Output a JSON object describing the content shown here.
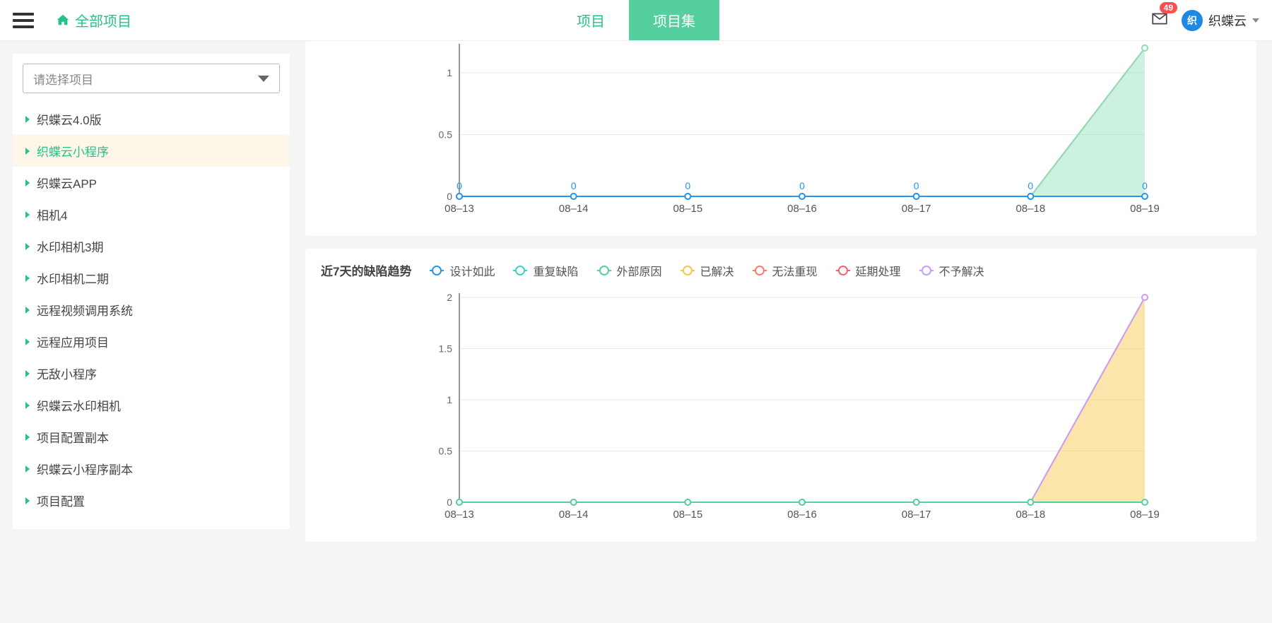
{
  "header": {
    "all_projects": "全部项目",
    "tab_project": "项目",
    "tab_collection": "项目集",
    "badge": "49",
    "username": "织蝶云"
  },
  "sidebar": {
    "select_placeholder": "请选择项目",
    "items": [
      {
        "label": "织蝶云4.0版",
        "active": false
      },
      {
        "label": "织蝶云小程序",
        "active": true
      },
      {
        "label": "织蝶云APP",
        "active": false
      },
      {
        "label": "相机4",
        "active": false
      },
      {
        "label": "水印相机3期",
        "active": false
      },
      {
        "label": "水印相机二期",
        "active": false
      },
      {
        "label": "远程视频调用系统",
        "active": false
      },
      {
        "label": "远程应用项目",
        "active": false
      },
      {
        "label": "无敌小程序",
        "active": false
      },
      {
        "label": "织蝶云水印相机",
        "active": false
      },
      {
        "label": "项目配置副本",
        "active": false
      },
      {
        "label": "织蝶云小程序副本",
        "active": false
      },
      {
        "label": "项目配置",
        "active": false
      }
    ]
  },
  "chart_data": [
    {
      "id": "top",
      "type": "area",
      "title": "",
      "categories": [
        "08–13",
        "08–14",
        "08–15",
        "08–16",
        "08–17",
        "08–18",
        "08–19"
      ],
      "yticks": [
        0,
        0.5,
        1
      ],
      "ylim": [
        0,
        1.2
      ],
      "series": [
        {
          "name": "red",
          "color": "#ff5a7a",
          "values": [
            0,
            0,
            0,
            0,
            0,
            0,
            1.2
          ],
          "fill": false
        },
        {
          "name": "green",
          "color": "#8fdfb9",
          "values": [
            0,
            0,
            0,
            0,
            0,
            0,
            1.2
          ],
          "fill": true
        },
        {
          "name": "blue",
          "color": "#2196f3",
          "values": [
            0,
            0,
            0,
            0,
            0,
            0,
            0
          ],
          "fill": false,
          "show_point_labels": true
        }
      ]
    },
    {
      "id": "defects7d",
      "type": "area",
      "title": "近7天的缺陷趋势",
      "categories": [
        "08–13",
        "08–14",
        "08–15",
        "08–16",
        "08–17",
        "08–18",
        "08–19"
      ],
      "yticks": [
        0,
        0.5,
        1,
        1.5,
        2
      ],
      "ylim": [
        0,
        2
      ],
      "legend": [
        {
          "name": "设计如此",
          "color": "#2196f3"
        },
        {
          "name": "重复缺陷",
          "color": "#35d4c7"
        },
        {
          "name": "外部原因",
          "color": "#54cf9d"
        },
        {
          "name": "已解决",
          "color": "#f6c544"
        },
        {
          "name": "无法重现",
          "color": "#ff7a6b"
        },
        {
          "name": "延期处理",
          "color": "#ff5a7a"
        },
        {
          "name": "不予解决",
          "color": "#c79bff"
        }
      ],
      "series": [
        {
          "name": "已解决",
          "color": "#f6c544",
          "values": [
            0,
            0,
            0,
            0,
            0,
            0,
            2
          ],
          "fill": true
        },
        {
          "name": "不予解决",
          "color": "#c79bff",
          "values": [
            0,
            0,
            0,
            0,
            0,
            0,
            2
          ],
          "fill": false
        },
        {
          "name": "外部原因",
          "color": "#54cf9d",
          "values": [
            0,
            0,
            0,
            0,
            0,
            0,
            0
          ],
          "fill": false
        }
      ]
    }
  ]
}
